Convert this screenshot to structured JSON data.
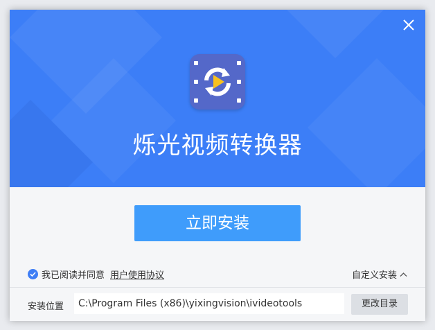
{
  "app": {
    "title": "烁光视频转换器"
  },
  "actions": {
    "install_label": "立即安装",
    "custom_install_label": "自定义安装"
  },
  "agreement": {
    "checked": true,
    "prefix": "我已阅读并同意",
    "link_label": "用户使用协议"
  },
  "install_path": {
    "label": "安装位置",
    "value": "C:\\Program Files (x86)\\yixingvision\\ivideotools",
    "change_label": "更改目录"
  },
  "colors": {
    "banner": "#3c7ef7",
    "button": "#3f9cfb",
    "logo_bg": "#5468c9",
    "play_icon": "#f7c11e"
  },
  "icons": {
    "close": "close-icon",
    "logo": "video-converter-logo-icon",
    "checkbox": "checkmark-icon",
    "expand": "chevron-up-icon"
  }
}
